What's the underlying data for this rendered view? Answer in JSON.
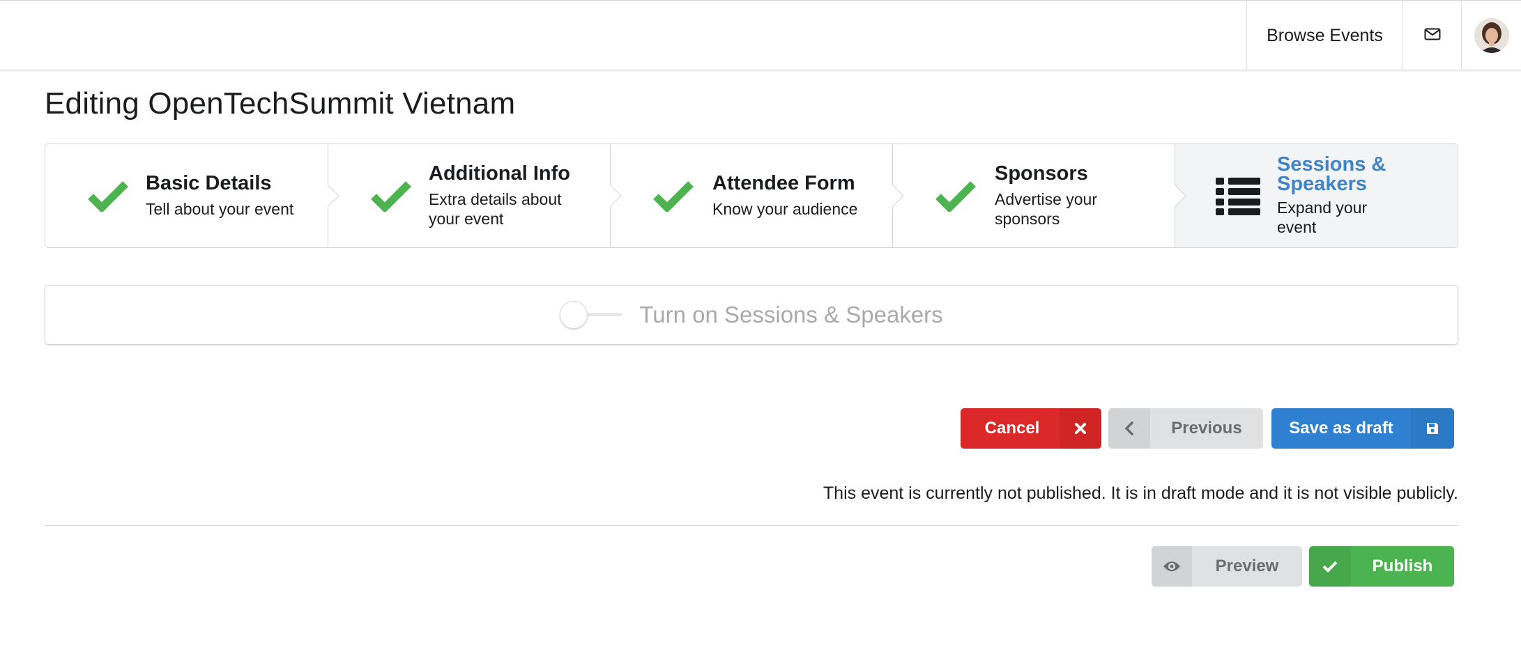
{
  "nav": {
    "browse_label": "Browse Events",
    "mail_icon": "envelope-icon",
    "avatar_icon": "user-avatar"
  },
  "page": {
    "title": "Editing OpenTechSummit Vietnam"
  },
  "steps": [
    {
      "title": "Basic Details",
      "description": "Tell about your event",
      "icon": "check-icon",
      "completed": true
    },
    {
      "title": "Additional Info",
      "description": "Extra details about your event",
      "icon": "check-icon",
      "completed": true
    },
    {
      "title": "Attendee Form",
      "description": "Know your audience",
      "icon": "check-icon",
      "completed": true
    },
    {
      "title": "Sponsors",
      "description": "Advertise your sponsors",
      "icon": "check-icon",
      "completed": true
    },
    {
      "title": "Sessions & Speakers",
      "description": "Expand your event",
      "icon": "list-icon",
      "active": true
    }
  ],
  "sessions_toggle": {
    "label": "Turn on Sessions & Speakers",
    "checked": false
  },
  "actions": {
    "cancel_label": "Cancel",
    "previous_label": "Previous",
    "save_label": "Save as draft"
  },
  "status": {
    "text": "This event is currently not published. It is in draft mode and it is not visible publicly."
  },
  "publish_actions": {
    "preview_label": "Preview",
    "publish_label": "Publish"
  },
  "colors": {
    "check_green": "#4db34f",
    "active_blue": "#4183c4",
    "cancel_red": "#db2828",
    "save_blue": "#2f80d0",
    "publish_green": "#4bb350"
  }
}
